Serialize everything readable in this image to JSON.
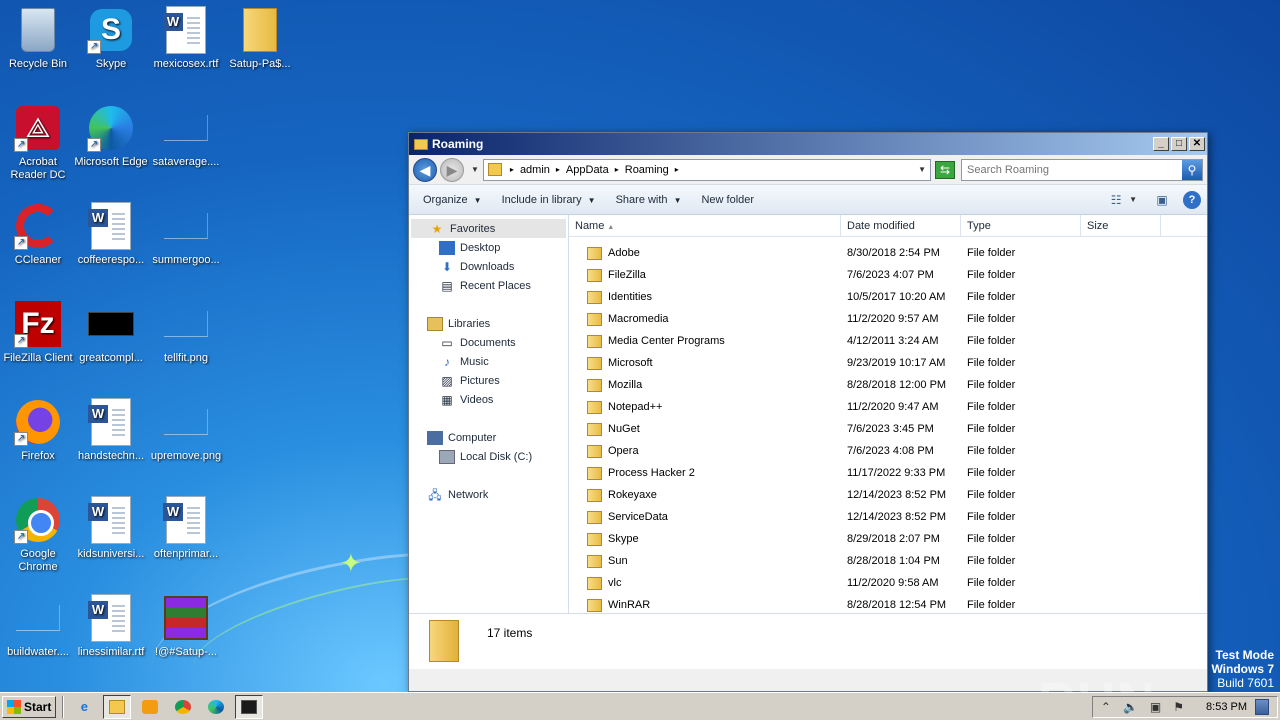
{
  "desktop": {
    "icons": [
      {
        "label": "Recycle Bin",
        "icon": "recycle-bin-icon"
      },
      {
        "label": "Skype",
        "icon": "skype-icon"
      },
      {
        "label": "mexicosex.rtf",
        "icon": "word-document-icon"
      },
      {
        "label": "Satup-Pa$...",
        "icon": "folder-zip-icon"
      },
      {
        "label": "Acrobat Reader DC",
        "icon": "acrobat-icon"
      },
      {
        "label": "Microsoft Edge",
        "icon": "edge-icon"
      },
      {
        "label": "sataverage....",
        "icon": "blank-file-icon"
      },
      {
        "label": "CCleaner",
        "icon": "ccleaner-icon"
      },
      {
        "label": "coffeerespo...",
        "icon": "word-document-icon"
      },
      {
        "label": "summergoo...",
        "icon": "blank-file-icon"
      },
      {
        "label": "FileZilla Client",
        "icon": "filezilla-icon"
      },
      {
        "label": "greatcompl...",
        "icon": "black-image-icon"
      },
      {
        "label": "tellfit.png",
        "icon": "blank-file-icon"
      },
      {
        "label": "Firefox",
        "icon": "firefox-icon"
      },
      {
        "label": "handstechn...",
        "icon": "word-document-icon"
      },
      {
        "label": "upremove.png",
        "icon": "blank-file-icon"
      },
      {
        "label": "Google Chrome",
        "icon": "chrome-icon"
      },
      {
        "label": "kidsuniversi...",
        "icon": "word-document-icon"
      },
      {
        "label": "oftenprimar...",
        "icon": "word-document-icon"
      },
      {
        "label": "buildwater....",
        "icon": "blank-file-icon"
      },
      {
        "label": "linessimilar.rtf",
        "icon": "word-document-icon"
      },
      {
        "label": "!@#Satup-...",
        "icon": "winrar-icon"
      }
    ]
  },
  "window": {
    "title": "Roaming",
    "breadcrumbs": [
      "admin",
      "AppData",
      "Roaming"
    ],
    "search_placeholder": "Search Roaming",
    "toolbar": {
      "organize": "Organize",
      "include_in_library": "Include in library",
      "share_with": "Share with",
      "new_folder": "New folder"
    },
    "nav": {
      "favorites": "Favorites",
      "desktop": "Desktop",
      "downloads": "Downloads",
      "recent_places": "Recent Places",
      "libraries": "Libraries",
      "documents": "Documents",
      "music": "Music",
      "pictures": "Pictures",
      "videos": "Videos",
      "computer": "Computer",
      "local_disk": "Local Disk (C:)",
      "network": "Network"
    },
    "columns": {
      "name": "Name",
      "date_modified": "Date modified",
      "type": "Type",
      "size": "Size"
    },
    "files": [
      {
        "name": "Adobe",
        "date": "8/30/2018 2:54 PM",
        "type": "File folder"
      },
      {
        "name": "FileZilla",
        "date": "7/6/2023 4:07 PM",
        "type": "File folder"
      },
      {
        "name": "Identities",
        "date": "10/5/2017 10:20 AM",
        "type": "File folder"
      },
      {
        "name": "Macromedia",
        "date": "11/2/2020 9:57 AM",
        "type": "File folder"
      },
      {
        "name": "Media Center Programs",
        "date": "4/12/2011 3:24 AM",
        "type": "File folder"
      },
      {
        "name": "Microsoft",
        "date": "9/23/2019 10:17 AM",
        "type": "File folder"
      },
      {
        "name": "Mozilla",
        "date": "8/28/2018 12:00 PM",
        "type": "File folder"
      },
      {
        "name": "Notepad++",
        "date": "11/2/2020 9:47 AM",
        "type": "File folder"
      },
      {
        "name": "NuGet",
        "date": "7/6/2023 3:45 PM",
        "type": "File folder"
      },
      {
        "name": "Opera",
        "date": "7/6/2023 4:08 PM",
        "type": "File folder"
      },
      {
        "name": "Process Hacker 2",
        "date": "11/17/2022 9:33 PM",
        "type": "File folder"
      },
      {
        "name": "Rokeyaxe",
        "date": "12/14/2023 8:52 PM",
        "type": "File folder"
      },
      {
        "name": "ServiceData",
        "date": "12/14/2023 8:52 PM",
        "type": "File folder"
      },
      {
        "name": "Skype",
        "date": "8/29/2018 2:07 PM",
        "type": "File folder"
      },
      {
        "name": "Sun",
        "date": "8/28/2018 1:04 PM",
        "type": "File folder"
      },
      {
        "name": "vlc",
        "date": "11/2/2020 9:58 AM",
        "type": "File folder"
      },
      {
        "name": "WinRAR",
        "date": "8/28/2018 12:54 PM",
        "type": "File folder"
      }
    ],
    "item_count": "17 items"
  },
  "taskbar": {
    "start_label": "Start",
    "clock": "8:53 PM"
  },
  "watermark": "ANY RUN",
  "test_mode": {
    "line1": "Test Mode",
    "line2": "Windows 7",
    "line3": "Build 7601"
  }
}
